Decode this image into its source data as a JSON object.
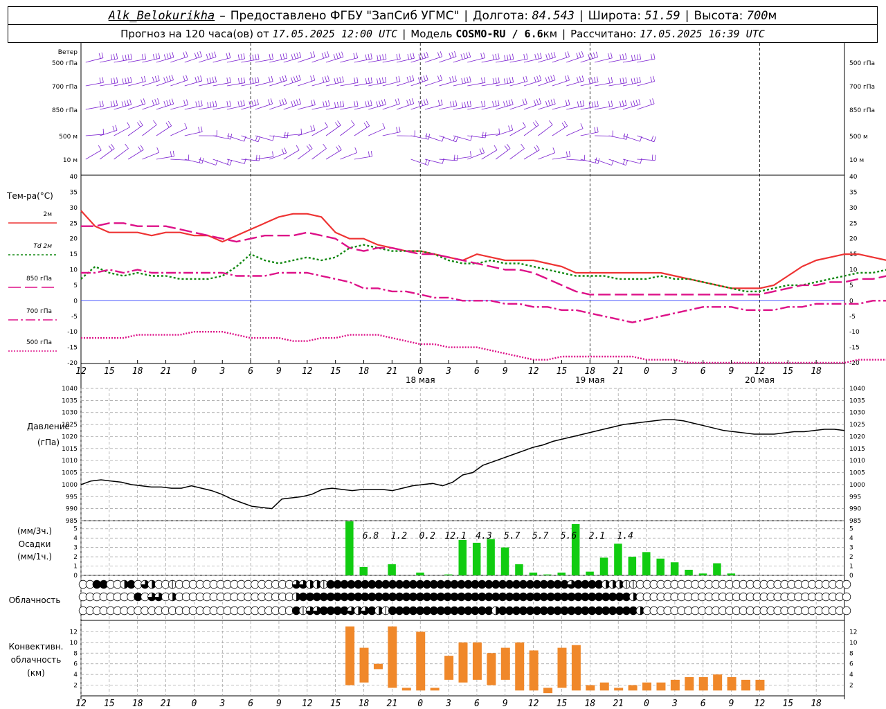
{
  "header": {
    "station": "Alk_Belokurikha",
    "dash": "–",
    "provider": "Предоставлено ФГБУ \"ЗапСиб УГМС\"",
    "lon_label": "Долгота:",
    "lon": "84.543",
    "lat_label": "Широта:",
    "lat": "51.59",
    "alt_label": "Высота:",
    "alt": "700",
    "alt_unit": "м",
    "forecast_prefix": "Прогноз на 120 часа(ов) от",
    "forecast_time": "17.05.2025 12:00 UTC",
    "model_label": "Модель",
    "model": "COSMO-RU / 6.6",
    "model_unit": "км",
    "computed_label": "Рассчитано:",
    "computed_time": "17.05.2025 16:39 UTC"
  },
  "wind_panel": {
    "title": "Ветер",
    "levels": [
      "500 гПа",
      "700 гПа",
      "850 гПа",
      "500 м",
      "10  м"
    ],
    "color": "#7a1fd0"
  },
  "chart_data": [
    {
      "type": "line",
      "ylabel": "Тем-ра(°C)",
      "ylim": [
        -20,
        40
      ],
      "yticks": [
        -20,
        -15,
        -10,
        -5,
        0,
        5,
        10,
        15,
        20,
        25,
        30,
        35,
        40
      ],
      "x_ticks": [
        "12",
        "15",
        "18",
        "21",
        "0",
        "3",
        "6",
        "9",
        "12",
        "15",
        "18",
        "21",
        "0",
        "3",
        "6",
        "9",
        "12",
        "15",
        "18",
        "21",
        "0",
        "3",
        "6",
        "9",
        "12",
        "15",
        "18"
      ],
      "day_labels": [
        "18 мая",
        "19 мая",
        "20 мая"
      ],
      "x_hours": [
        0,
        3,
        6,
        9,
        12,
        15,
        18,
        21,
        24,
        27,
        30,
        33,
        36,
        39,
        42,
        45,
        48,
        51,
        54,
        57,
        60,
        63,
        66,
        69,
        72,
        75,
        78,
        81,
        84,
        87,
        90,
        93,
        96,
        99,
        102,
        105,
        108,
        111,
        114,
        117,
        120,
        123,
        126,
        129,
        132,
        135,
        138,
        141,
        144,
        147,
        150,
        153,
        156,
        159,
        162,
        165,
        168,
        171,
        174,
        177,
        180
      ],
      "series": [
        {
          "name": "2м",
          "color": "#ee3333",
          "dash": "",
          "values": [
            29,
            24,
            22,
            22,
            22,
            21,
            22,
            22,
            21,
            21,
            19,
            21,
            23,
            25,
            27,
            28,
            28,
            27,
            22,
            20,
            20,
            18,
            17,
            16,
            16,
            15,
            14,
            13,
            15,
            14,
            13,
            13,
            13,
            12,
            11,
            9,
            9,
            9,
            9,
            9,
            9,
            9,
            8,
            7,
            6,
            5,
            4,
            4,
            4,
            5,
            8,
            11,
            13,
            14,
            15,
            15,
            14,
            13,
            11,
            9,
            7
          ]
        },
        {
          "name": "Td 2м",
          "color": "#118811",
          "dash": "3,3",
          "values": [
            7,
            11,
            9,
            8,
            9,
            8,
            8,
            7,
            7,
            7,
            8,
            11,
            15,
            13,
            12,
            13,
            14,
            13,
            14,
            17,
            18,
            17,
            16,
            16,
            16,
            15,
            13,
            12,
            12,
            13,
            12,
            12,
            11,
            10,
            9,
            8,
            8,
            8,
            7,
            7,
            7,
            8,
            7,
            7,
            6,
            5,
            4,
            3,
            3,
            4,
            5,
            5,
            6,
            7,
            8,
            9,
            9,
            10,
            9,
            7,
            5
          ]
        },
        {
          "name": "850 гПа",
          "color": "#dd1188",
          "dash": "18,6",
          "values": [
            24,
            24,
            25,
            25,
            24,
            24,
            24,
            23,
            22,
            21,
            20,
            19,
            20,
            21,
            21,
            21,
            22,
            21,
            20,
            17,
            16,
            17,
            17,
            16,
            15,
            15,
            14,
            13,
            12,
            11,
            10,
            10,
            9,
            7,
            5,
            3,
            2,
            2,
            2,
            2,
            2,
            2,
            2,
            2,
            2,
            2,
            2,
            2,
            2,
            3,
            4,
            5,
            5,
            6,
            6,
            7,
            7,
            8,
            9,
            10,
            10
          ]
        },
        {
          "name": "700 гПа",
          "color": "#dd1188",
          "dash": "14,4,3,4",
          "values": [
            9,
            9,
            10,
            9,
            10,
            9,
            9,
            9,
            9,
            9,
            9,
            8,
            8,
            8,
            9,
            9,
            9,
            8,
            7,
            6,
            4,
            4,
            3,
            3,
            2,
            1,
            1,
            0,
            0,
            0,
            -1,
            -1,
            -2,
            -2,
            -3,
            -3,
            -4,
            -5,
            -6,
            -7,
            -6,
            -5,
            -4,
            -3,
            -2,
            -2,
            -2,
            -3,
            -3,
            -3,
            -2,
            -2,
            -1,
            -1,
            -1,
            -1,
            0,
            0,
            0,
            0,
            0
          ]
        },
        {
          "name": "500 гПа",
          "color": "#dd1188",
          "dash": "2,2",
          "values": [
            -12,
            -12,
            -12,
            -12,
            -11,
            -11,
            -11,
            -11,
            -10,
            -10,
            -10,
            -11,
            -12,
            -12,
            -12,
            -13,
            -13,
            -12,
            -12,
            -11,
            -11,
            -11,
            -12,
            -13,
            -14,
            -14,
            -15,
            -15,
            -15,
            -16,
            -17,
            -18,
            -19,
            -19,
            -18,
            -18,
            -18,
            -18,
            -18,
            -18,
            -19,
            -19,
            -19,
            -20,
            -20,
            -20,
            -20,
            -20,
            -20,
            -20,
            -20,
            -20,
            -20,
            -20,
            -20,
            -19,
            -19,
            -19,
            -19,
            -19,
            -19
          ]
        }
      ]
    },
    {
      "type": "line",
      "ylabel": "Давление",
      "ylabel2": "(гПа)",
      "ylim": [
        985,
        1040
      ],
      "yticks": [
        985,
        990,
        995,
        1000,
        1005,
        1010,
        1015,
        1020,
        1025,
        1030,
        1035,
        1040
      ],
      "series": [
        {
          "name": "Давление",
          "color": "#000000",
          "values": [
            1000,
            1001.5,
            1002,
            1001.5,
            1001,
            1000,
            999.5,
            999,
            999,
            998.5,
            998.5,
            999.5,
            998.5,
            997.5,
            996,
            994,
            992.5,
            991,
            990.5,
            990,
            994,
            994.5,
            995,
            996,
            998,
            998.5,
            998,
            997.5,
            998,
            998,
            998,
            997.5,
            998.5,
            999.5,
            1000,
            1000.5,
            999.5,
            1001,
            1004,
            1005,
            1008,
            1009.5,
            1011,
            1012.5,
            1014,
            1015.5,
            1016.5,
            1018,
            1019,
            1020,
            1021,
            1022,
            1023,
            1024,
            1025,
            1025.5,
            1026,
            1026.5,
            1027,
            1027,
            1026.5,
            1025.5,
            1024.5,
            1023.5,
            1022.5,
            1022,
            1021.5,
            1021,
            1021,
            1021,
            1021.5,
            1022,
            1022,
            1022.5,
            1023,
            1023,
            1022.5
          ]
        }
      ]
    },
    {
      "type": "bar",
      "ylabel": "(мм/3ч.)",
      "ylabel2": "Осадки",
      "ylabel3": "(мм/1ч.)",
      "ylim": [
        0,
        5.5
      ],
      "yticks": [
        0,
        1,
        2,
        3,
        4,
        5
      ],
      "color": "#11cc11",
      "bars": [
        {
          "hour": 57,
          "value": 5.8
        },
        {
          "hour": 60,
          "value": 0.9
        },
        {
          "hour": 66,
          "value": 1.2
        },
        {
          "hour": 72,
          "value": 0.3
        },
        {
          "hour": 78,
          "value": 0.1
        },
        {
          "hour": 81,
          "value": 3.8
        },
        {
          "hour": 84,
          "value": 3.5
        },
        {
          "hour": 87,
          "value": 3.9
        },
        {
          "hour": 90,
          "value": 3.0
        },
        {
          "hour": 93,
          "value": 1.2
        },
        {
          "hour": 96,
          "value": 0.3
        },
        {
          "hour": 99,
          "value": 0.1
        },
        {
          "hour": 102,
          "value": 0.3
        },
        {
          "hour": 105,
          "value": 5.5
        },
        {
          "hour": 108,
          "value": 0.4
        },
        {
          "hour": 111,
          "value": 1.9
        },
        {
          "hour": 114,
          "value": 3.4
        },
        {
          "hour": 117,
          "value": 2.0
        },
        {
          "hour": 120,
          "value": 2.5
        },
        {
          "hour": 123,
          "value": 1.8
        },
        {
          "hour": 126,
          "value": 1.4
        },
        {
          "hour": 129,
          "value": 0.6
        },
        {
          "hour": 132,
          "value": 0.2
        },
        {
          "hour": 135,
          "value": 1.3
        },
        {
          "hour": 138,
          "value": 0.2
        }
      ],
      "labels": [
        {
          "hour": 60,
          "text": "6.8"
        },
        {
          "hour": 66,
          "text": "1.2"
        },
        {
          "hour": 72,
          "text": "0.2"
        },
        {
          "hour": 78,
          "text": "12.1"
        },
        {
          "hour": 84,
          "text": "4.3"
        },
        {
          "hour": 90,
          "text": "5.7"
        },
        {
          "hour": 96,
          "text": "5.7"
        },
        {
          "hour": 102,
          "text": "5.6"
        },
        {
          "hour": 108,
          "text": "2.1"
        },
        {
          "hour": 114,
          "text": "1.4"
        }
      ]
    },
    {
      "type": "bar",
      "ylabel": "Конвективн.",
      "ylabel2": "облачность",
      "ylabel3": "(км)",
      "ylim": [
        0,
        14
      ],
      "yticks": [
        2,
        4,
        6,
        8,
        10,
        12
      ],
      "color": "#f0882a",
      "ranges": [
        {
          "hour": 57,
          "base": 2,
          "top": 13
        },
        {
          "hour": 60,
          "base": 2.5,
          "top": 9
        },
        {
          "hour": 63,
          "base": 5,
          "top": 6
        },
        {
          "hour": 66,
          "base": 1.5,
          "top": 13
        },
        {
          "hour": 69,
          "base": 1,
          "top": 1.5
        },
        {
          "hour": 72,
          "base": 1,
          "top": 12
        },
        {
          "hour": 75,
          "base": 1,
          "top": 1.5
        },
        {
          "hour": 78,
          "base": 3,
          "top": 7.5
        },
        {
          "hour": 81,
          "base": 2.5,
          "top": 10
        },
        {
          "hour": 84,
          "base": 3,
          "top": 10
        },
        {
          "hour": 87,
          "base": 2,
          "top": 8
        },
        {
          "hour": 90,
          "base": 3,
          "top": 9
        },
        {
          "hour": 93,
          "base": 1,
          "top": 10
        },
        {
          "hour": 96,
          "base": 1,
          "top": 8.5
        },
        {
          "hour": 99,
          "base": 0.5,
          "top": 1.5
        },
        {
          "hour": 102,
          "base": 1.5,
          "top": 9
        },
        {
          "hour": 105,
          "base": 1,
          "top": 9.5
        },
        {
          "hour": 108,
          "base": 1,
          "top": 2
        },
        {
          "hour": 111,
          "base": 1,
          "top": 2.5
        },
        {
          "hour": 114,
          "base": 1,
          "top": 1.5
        },
        {
          "hour": 117,
          "base": 1,
          "top": 2
        },
        {
          "hour": 120,
          "base": 1,
          "top": 2.5
        },
        {
          "hour": 123,
          "base": 1,
          "top": 2.5
        },
        {
          "hour": 126,
          "base": 1,
          "top": 3
        },
        {
          "hour": 129,
          "base": 1,
          "top": 3.5
        },
        {
          "hour": 132,
          "base": 1,
          "top": 3.5
        },
        {
          "hour": 135,
          "base": 1,
          "top": 4
        },
        {
          "hour": 138,
          "base": 1,
          "top": 3.5
        },
        {
          "hour": 141,
          "base": 1,
          "top": 3
        },
        {
          "hour": 144,
          "base": 1,
          "top": 3
        }
      ]
    }
  ],
  "clouds": {
    "label": "Облачность",
    "rows": [
      [
        0,
        0,
        4,
        4,
        0,
        0,
        2,
        4,
        0,
        3,
        2,
        0,
        0,
        1,
        0,
        0,
        0,
        0,
        0,
        0,
        0,
        0,
        0,
        0,
        0,
        0,
        0,
        0,
        0,
        0,
        0,
        3,
        3,
        2,
        2,
        1,
        4,
        4,
        4,
        4,
        4,
        4,
        4,
        4,
        4,
        4,
        4,
        4,
        4,
        4,
        4,
        4,
        4,
        4,
        4,
        4,
        4,
        4,
        4,
        4,
        4,
        4,
        4,
        4,
        4,
        4,
        4,
        4,
        4,
        4,
        4,
        3,
        4,
        4,
        4,
        4,
        2,
        2,
        2,
        1,
        1,
        0,
        0,
        0,
        0,
        0,
        0,
        0,
        0,
        0,
        0,
        0,
        0,
        0,
        0,
        0,
        0,
        0,
        0,
        0,
        0,
        0,
        0,
        0,
        0,
        0,
        0,
        0,
        0,
        0,
        0,
        0
      ],
      [
        0,
        0,
        0,
        0,
        0,
        0,
        0,
        0,
        4,
        0,
        3,
        3,
        0,
        2,
        0,
        0,
        0,
        0,
        0,
        0,
        0,
        0,
        0,
        0,
        0,
        0,
        0,
        0,
        0,
        0,
        0,
        2,
        4,
        4,
        4,
        4,
        4,
        4,
        4,
        4,
        4,
        4,
        4,
        4,
        4,
        4,
        4,
        4,
        4,
        4,
        4,
        4,
        4,
        4,
        4,
        4,
        4,
        4,
        4,
        4,
        4,
        4,
        4,
        4,
        4,
        4,
        4,
        4,
        4,
        4,
        4,
        4,
        4,
        4,
        4,
        4,
        4,
        4,
        4,
        4,
        2,
        0,
        0,
        0,
        0,
        0,
        0,
        0,
        0,
        0,
        0,
        0,
        0,
        0,
        0,
        0,
        0,
        0,
        0,
        0,
        0,
        0,
        0,
        0,
        0,
        0,
        0,
        0,
        0,
        0,
        0,
        0
      ],
      [
        0,
        0,
        0,
        0,
        0,
        0,
        0,
        0,
        0,
        0,
        0,
        0,
        0,
        0,
        0,
        0,
        0,
        0,
        0,
        0,
        0,
        0,
        0,
        0,
        0,
        0,
        0,
        0,
        0,
        0,
        0,
        4,
        1,
        3,
        3,
        4,
        4,
        4,
        4,
        3,
        2,
        3,
        4,
        2,
        1,
        4,
        4,
        4,
        4,
        4,
        4,
        4,
        4,
        4,
        4,
        4,
        4,
        4,
        4,
        4,
        2,
        4,
        4,
        4,
        4,
        4,
        4,
        4,
        4,
        4,
        4,
        4,
        4,
        4,
        4,
        4,
        4,
        4,
        4,
        4,
        4,
        2,
        0,
        0,
        0,
        0,
        0,
        0,
        0,
        0,
        0,
        0,
        0,
        0,
        0,
        0,
        0,
        0,
        0,
        0,
        0,
        0,
        0,
        0,
        0,
        0,
        0,
        0,
        0,
        0,
        0,
        0
      ]
    ]
  }
}
